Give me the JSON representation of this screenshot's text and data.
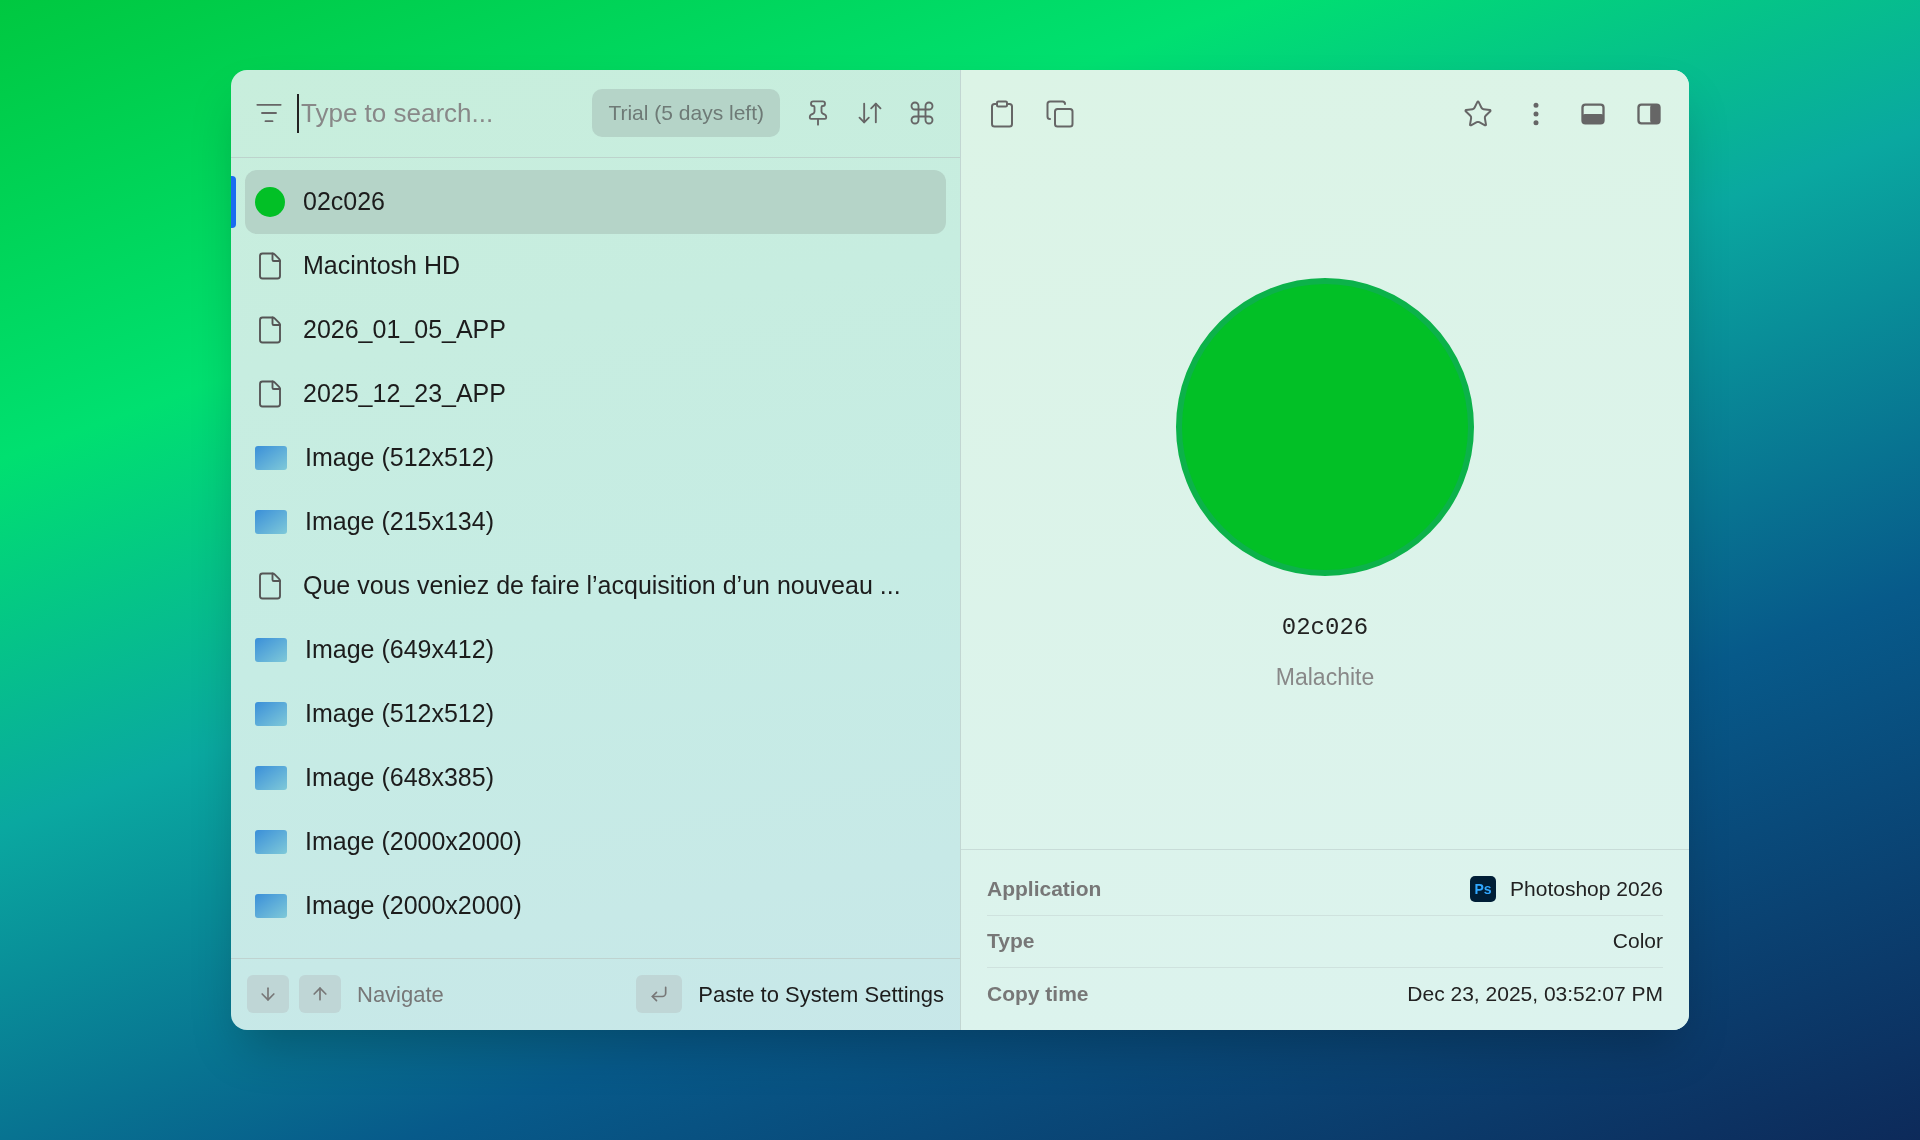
{
  "search": {
    "placeholder": "Type to search...",
    "badge": "Trial (5 days left)"
  },
  "items": [
    {
      "kind": "color",
      "label": "02c026",
      "color": "#02c026",
      "selected": true
    },
    {
      "kind": "file",
      "label": "Macintosh HD",
      "selected": false
    },
    {
      "kind": "file",
      "label": "2026_01_05_APP",
      "selected": false
    },
    {
      "kind": "file",
      "label": "2025_12_23_APP",
      "selected": false
    },
    {
      "kind": "image",
      "label": "Image (512x512)",
      "selected": false
    },
    {
      "kind": "image",
      "label": "Image (215x134)",
      "selected": false
    },
    {
      "kind": "file",
      "label": "Que vous veniez de faire l’acquisition d’un nouveau ...",
      "selected": false
    },
    {
      "kind": "image",
      "label": "Image (649x412)",
      "selected": false
    },
    {
      "kind": "image",
      "label": "Image (512x512)",
      "selected": false
    },
    {
      "kind": "image",
      "label": "Image (648x385)",
      "selected": false
    },
    {
      "kind": "image",
      "label": "Image (2000x2000)",
      "selected": false
    },
    {
      "kind": "image",
      "label": "Image (2000x2000)",
      "selected": false
    }
  ],
  "footer": {
    "navigate": "Navigate",
    "action": "Paste to System Settings"
  },
  "preview": {
    "color": "#02c026",
    "code": "02c026",
    "name": "Malachite"
  },
  "details": [
    {
      "label": "Application",
      "value": "Photoshop 2026",
      "app_badge": "Ps"
    },
    {
      "label": "Type",
      "value": "Color"
    },
    {
      "label": "Copy time",
      "value": "Dec 23, 2025, 03:52:07 PM"
    }
  ]
}
